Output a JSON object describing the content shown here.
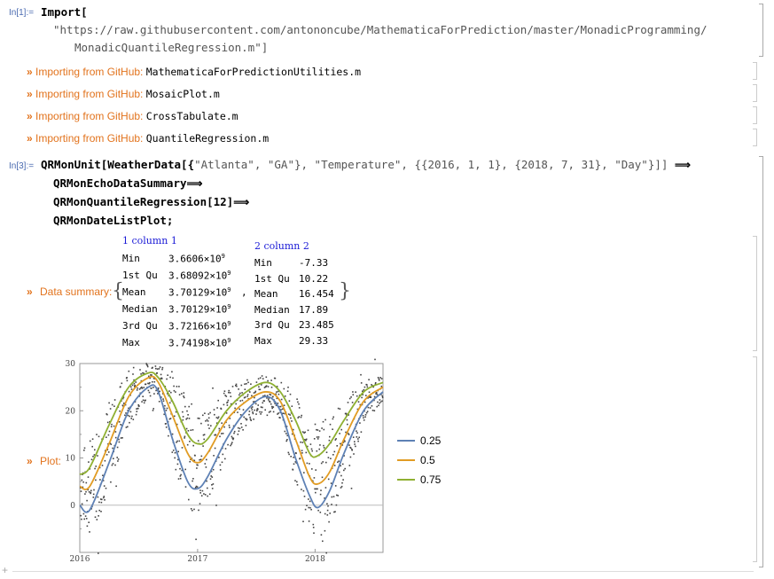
{
  "cell1": {
    "in_label": "In[1]:=",
    "func": "Import[",
    "url": "\"https://raw.githubusercontent.com/antononcube/MathematicaForPrediction/master/MonadicProgramming/",
    "url2": "MonadicQuantileRegression.m\"]"
  },
  "imports": [
    {
      "bullet": "»",
      "prefix": "Importing from GitHub:",
      "file": "MathematicaForPredictionUtilities.m"
    },
    {
      "bullet": "»",
      "prefix": "Importing from GitHub:",
      "file": "MosaicPlot.m"
    },
    {
      "bullet": "»",
      "prefix": "Importing from GitHub:",
      "file": "CrossTabulate.m"
    },
    {
      "bullet": "»",
      "prefix": "Importing from GitHub:",
      "file": "QuantileRegression.m"
    }
  ],
  "cell3": {
    "in_label": "In[3]:=",
    "line1a": "QRMonUnit[WeatherData[{",
    "line1b": "\"Atlanta\", \"GA\"}, \"Temperature\", {{2016, 1, 1}, {2018, 7, 31}, \"Day\"}]]",
    "arrow": "⟹",
    "line2": "QRMonEchoDataSummary",
    "line3": "QRMonQuantileRegression[12]",
    "line4": "QRMonDateListPlot;"
  },
  "summary": {
    "bullet": "»",
    "label": "Data summary:",
    "col1_title": "1 column 1",
    "col2_title": "2 column 2",
    "col1": [
      {
        "k": "Min",
        "m": "3.6606",
        "e": "9"
      },
      {
        "k": "1st Qu",
        "m": "3.68092",
        "e": "9"
      },
      {
        "k": "Mean",
        "m": "3.70129",
        "e": "9"
      },
      {
        "k": "Median",
        "m": "3.70129",
        "e": "9"
      },
      {
        "k": "3rd Qu",
        "m": "3.72166",
        "e": "9"
      },
      {
        "k": "Max",
        "m": "3.74198",
        "e": "9"
      }
    ],
    "col2": [
      {
        "k": "Min",
        "v": "-7.33"
      },
      {
        "k": "1st Qu",
        "v": "10.22"
      },
      {
        "k": "Mean",
        "v": "16.454"
      },
      {
        "k": "Median",
        "v": "17.89"
      },
      {
        "k": "3rd Qu",
        "v": "23.485"
      },
      {
        "k": "Max",
        "v": "29.33"
      }
    ],
    "times": "×10",
    "comma": ","
  },
  "plot": {
    "bullet": "»",
    "label": "Plot:",
    "colors": {
      "q25": "#5e81b5",
      "q50": "#e19c24",
      "q75": "#8fb032",
      "points": "#444444",
      "axis": "#999999"
    },
    "legend": [
      "0.25",
      "0.5",
      "0.75"
    ]
  },
  "chart_data": {
    "type": "line",
    "x_ticks": [
      "2016",
      "2017",
      "2018"
    ],
    "y_ticks": [
      "0",
      "10",
      "20",
      "30"
    ],
    "ylim": [
      -10,
      30
    ],
    "xlim": [
      "2016-01-01",
      "2018-07-31"
    ],
    "series": [
      {
        "name": "0.25",
        "points": [
          [
            "2016-01-01",
            0
          ],
          [
            "2016-02-01",
            -1
          ],
          [
            "2016-04-01",
            9
          ],
          [
            "2016-06-01",
            20
          ],
          [
            "2016-08-01",
            25
          ],
          [
            "2016-09-01",
            24
          ],
          [
            "2016-10-15",
            14
          ],
          [
            "2016-12-01",
            5
          ],
          [
            "2017-01-01",
            3.5
          ],
          [
            "2017-02-01",
            6
          ],
          [
            "2017-04-01",
            14
          ],
          [
            "2017-06-01",
            20
          ],
          [
            "2017-08-01",
            23
          ],
          [
            "2017-09-15",
            20
          ],
          [
            "2017-11-01",
            10
          ],
          [
            "2017-12-15",
            2
          ],
          [
            "2018-01-10",
            -0.5
          ],
          [
            "2018-02-15",
            3
          ],
          [
            "2018-04-01",
            11
          ],
          [
            "2018-06-01",
            20
          ],
          [
            "2018-07-31",
            24
          ]
        ]
      },
      {
        "name": "0.5",
        "points": [
          [
            "2016-01-01",
            4
          ],
          [
            "2016-02-01",
            4
          ],
          [
            "2016-04-01",
            13
          ],
          [
            "2016-06-01",
            23
          ],
          [
            "2016-08-01",
            27
          ],
          [
            "2016-09-01",
            26
          ],
          [
            "2016-10-15",
            19
          ],
          [
            "2016-12-01",
            11
          ],
          [
            "2017-01-01",
            9
          ],
          [
            "2017-02-01",
            11
          ],
          [
            "2017-04-01",
            18
          ],
          [
            "2017-06-01",
            22
          ],
          [
            "2017-08-01",
            24
          ],
          [
            "2017-09-15",
            22
          ],
          [
            "2017-11-01",
            14
          ],
          [
            "2017-12-15",
            6
          ],
          [
            "2018-01-10",
            4.5
          ],
          [
            "2018-02-15",
            7
          ],
          [
            "2018-04-01",
            14
          ],
          [
            "2018-06-01",
            22
          ],
          [
            "2018-07-31",
            25
          ]
        ]
      },
      {
        "name": "0.75",
        "points": [
          [
            "2016-01-01",
            6.5
          ],
          [
            "2016-02-01",
            8
          ],
          [
            "2016-04-01",
            17
          ],
          [
            "2016-06-01",
            25
          ],
          [
            "2016-08-01",
            28
          ],
          [
            "2016-09-01",
            27
          ],
          [
            "2016-10-15",
            22
          ],
          [
            "2016-12-01",
            15
          ],
          [
            "2017-01-01",
            13
          ],
          [
            "2017-02-01",
            14
          ],
          [
            "2017-04-01",
            20
          ],
          [
            "2017-06-01",
            24
          ],
          [
            "2017-08-01",
            26
          ],
          [
            "2017-09-15",
            24
          ],
          [
            "2017-11-01",
            18
          ],
          [
            "2017-12-15",
            11
          ],
          [
            "2018-01-10",
            10.5
          ],
          [
            "2018-02-15",
            13
          ],
          [
            "2018-04-01",
            18
          ],
          [
            "2018-06-01",
            24
          ],
          [
            "2018-07-31",
            26
          ]
        ]
      }
    ]
  }
}
